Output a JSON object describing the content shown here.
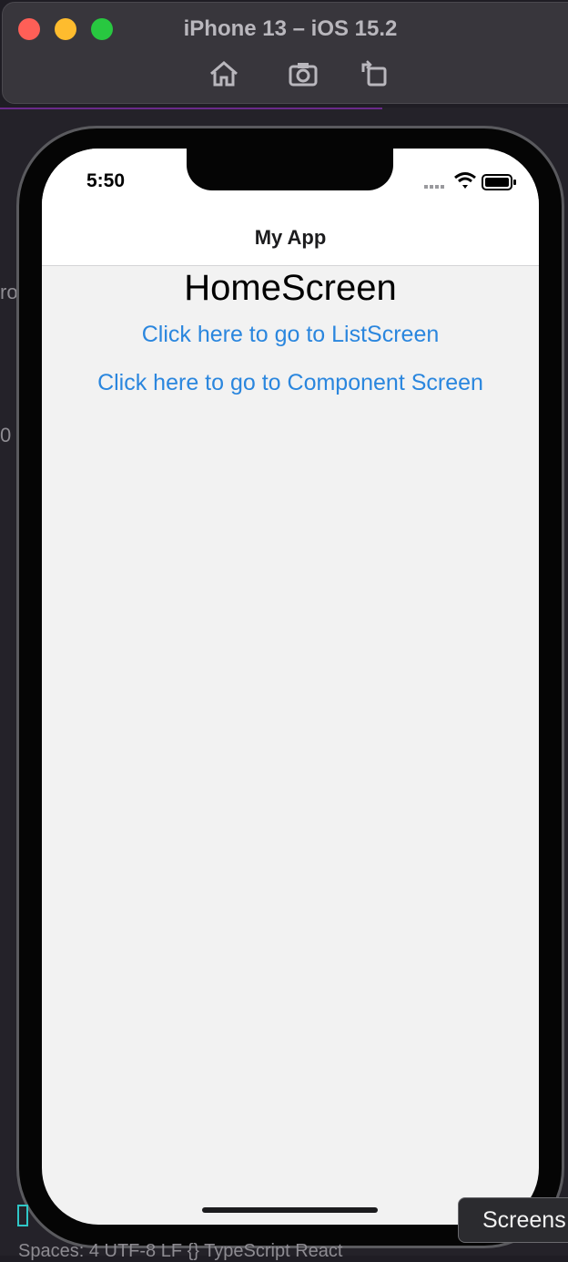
{
  "simulator": {
    "title": "iPhone 13 – iOS 15.2",
    "toolbar": [
      "home-icon",
      "screenshot-icon",
      "rotate-icon"
    ]
  },
  "status_bar": {
    "time": "5:50"
  },
  "nav": {
    "title": "My App"
  },
  "screen": {
    "title": "HomeScreen",
    "links": [
      "Click here to go to ListScreen",
      "Click here to go to Component Screen"
    ]
  },
  "tooltip": {
    "label": "Screens"
  },
  "editor_status": {
    "text": "Spaces: 4   UTF-8   LF   {} TypeScript React"
  },
  "colors": {
    "link": "#2a86de",
    "screen_bg": "#f2f2f2",
    "nav_bg": "#ffffff"
  }
}
